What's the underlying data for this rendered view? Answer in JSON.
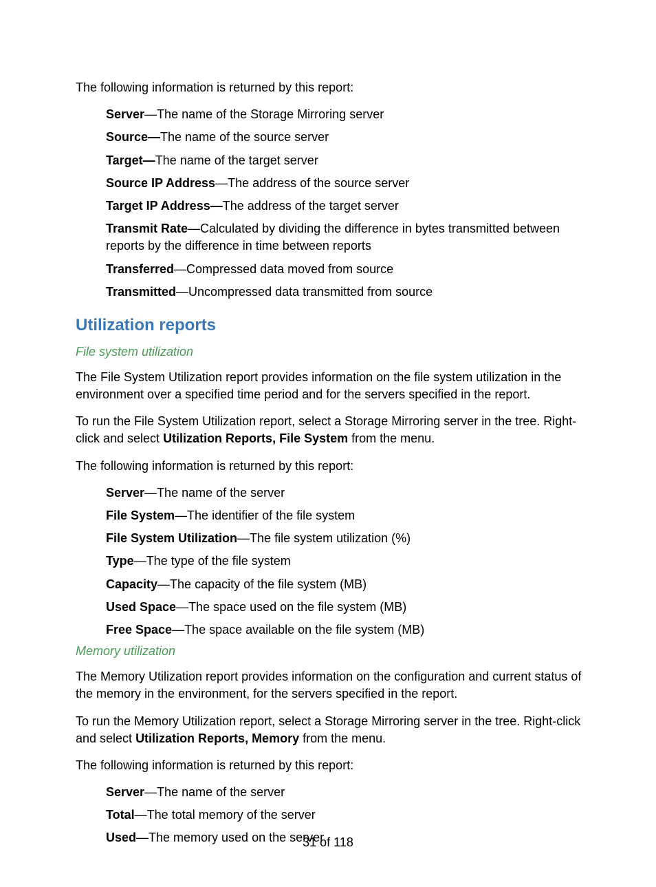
{
  "intro1": "The following information is returned by this report:",
  "section1_defs": [
    {
      "term": "Server",
      "desc": "—The name of the Storage Mirroring server"
    },
    {
      "term": "Source—",
      "desc": "The name of the source server"
    },
    {
      "term": "Target—",
      "desc": "The name of the target server"
    },
    {
      "term": "Source IP Address",
      "desc": "—The address of the source server"
    },
    {
      "term": "Target IP Address—",
      "desc": "The address of the target server"
    },
    {
      "term": "Transmit Rate",
      "desc": "—Calculated by dividing the difference in bytes transmitted between reports by the difference in time between reports"
    },
    {
      "term": "Transferred",
      "desc": "—Compressed data moved from source"
    },
    {
      "term": "Transmitted",
      "desc": "—Uncompressed data transmitted from source"
    }
  ],
  "heading_util": "Utilization reports",
  "fs": {
    "heading": "File system utilization",
    "p1": "The File System  Utilization report provides information on the file system utilization in the environment over a specified time period and for the servers specified in the report.",
    "p2_a": "To run the File System Utilization report, select a Storage Mirroring server in the tree. Right-click and select ",
    "p2_bold": "Utilization Reports, File System",
    "p2_b": " from the menu.",
    "p3": "The following information is returned by this report:",
    "defs": [
      {
        "term": "Server",
        "desc": "—The name of the server"
      },
      {
        "term": "File System",
        "desc": "—The identifier of the file system"
      },
      {
        "term": "File System Utilization",
        "desc": "—The file system utilization (%)"
      },
      {
        "term": "Type",
        "desc": "—The type of the file system"
      },
      {
        "term": "Capacity",
        "desc": "—The capacity of the file system (MB)"
      },
      {
        "term": "Used Space",
        "desc": "—The space used on the file system (MB)"
      },
      {
        "term": "Free Space",
        "desc": "—The space available on the file system (MB)"
      }
    ]
  },
  "mem": {
    "heading": "Memory utilization",
    "p1": "The Memory Utilization report provides information on the configuration and current status of the memory in the environment, for the servers specified in the report.",
    "p2_a": "To run the Memory Utilization report, select a Storage Mirroring server in the tree. Right-click and select ",
    "p2_bold": "Utilization Reports, Memory",
    "p2_b": " from the menu.",
    "p3": "The following information is returned by this report:",
    "defs": [
      {
        "term": "Server",
        "desc": "—The name of the server"
      },
      {
        "term": "Total",
        "desc": "—The total memory of the server"
      },
      {
        "term": "Used",
        "desc": "—The memory used on the server"
      }
    ]
  },
  "page_number": "31 of 118"
}
